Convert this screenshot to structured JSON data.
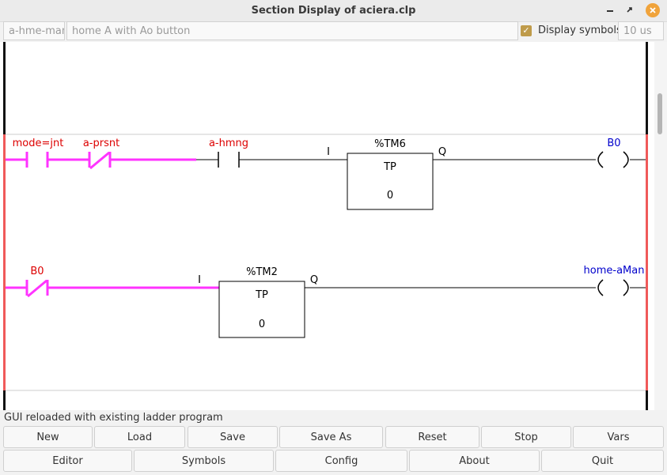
{
  "window": {
    "title": "Section Display of aciera.clp"
  },
  "toolbar": {
    "section_name": "a-hme-man",
    "section_comment": "home A with Ao button",
    "display_symbols_label": "Display symbols",
    "display_symbols_checked": true,
    "cycle_time": "10 us"
  },
  "ladder": {
    "rung1": {
      "contact1_label": "mode=jnt",
      "contact2_label": "a-prsnt",
      "contact3_label": "a-hmng",
      "timer_name": "%TM6",
      "timer_type": "TP",
      "timer_value": "0",
      "timer_input": "I",
      "timer_output": "Q",
      "coil_label": "B0"
    },
    "rung2": {
      "contact1_label": "B0",
      "timer_name": "%TM2",
      "timer_type": "TP",
      "timer_value": "0",
      "timer_input": "I",
      "timer_output": "Q",
      "coil_label": "home-aMan"
    },
    "colors": {
      "active": "#ff33ff",
      "inactive": "#000000",
      "variable_label": "#dd0000",
      "coil_label": "#0000cc",
      "power_rail": "#f05a5a"
    }
  },
  "status": {
    "message": "GUI reloaded with existing ladder program"
  },
  "buttons": {
    "row1": [
      "New",
      "Load",
      "Save",
      "Save As",
      "Reset",
      "Stop",
      "Vars"
    ],
    "row2": [
      "Editor",
      "Symbols",
      "Config",
      "About",
      "Quit"
    ]
  }
}
